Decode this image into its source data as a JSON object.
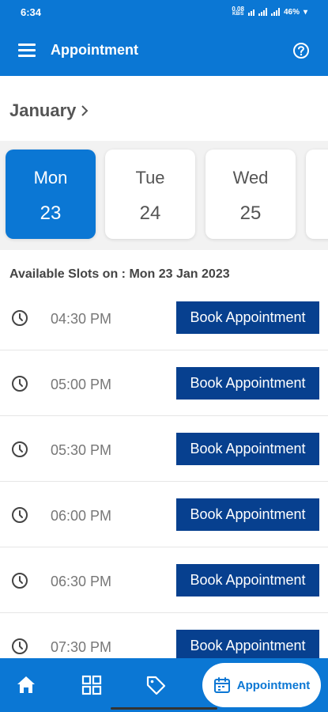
{
  "status_bar": {
    "time": "6:34",
    "network_speed": "0.08",
    "network_unit": "KB/S",
    "battery": "46%"
  },
  "app_bar": {
    "title": "Appointment",
    "menu_icon": "hamburger-menu-icon",
    "help_icon": "help-circle-icon"
  },
  "calendar": {
    "month": "January",
    "days": [
      {
        "name": "Mon",
        "date": "23",
        "selected": true
      },
      {
        "name": "Tue",
        "date": "24",
        "selected": false
      },
      {
        "name": "Wed",
        "date": "25",
        "selected": false
      }
    ]
  },
  "slots": {
    "heading": "Available Slots on : Mon 23 Jan 2023",
    "button_label": "Book Appointment",
    "times": [
      "04:30 PM",
      "05:00 PM",
      "05:30 PM",
      "06:00 PM",
      "06:30 PM",
      "07:30 PM"
    ]
  },
  "bottom_nav": {
    "items": [
      {
        "icon": "home-icon"
      },
      {
        "icon": "grid-icon"
      },
      {
        "icon": "tag-icon"
      }
    ],
    "active_label": "Appointment",
    "active_icon": "calendar-icon"
  },
  "colors": {
    "primary": "#0b77d4",
    "button": "#07408f",
    "text_gray": "#555555"
  }
}
